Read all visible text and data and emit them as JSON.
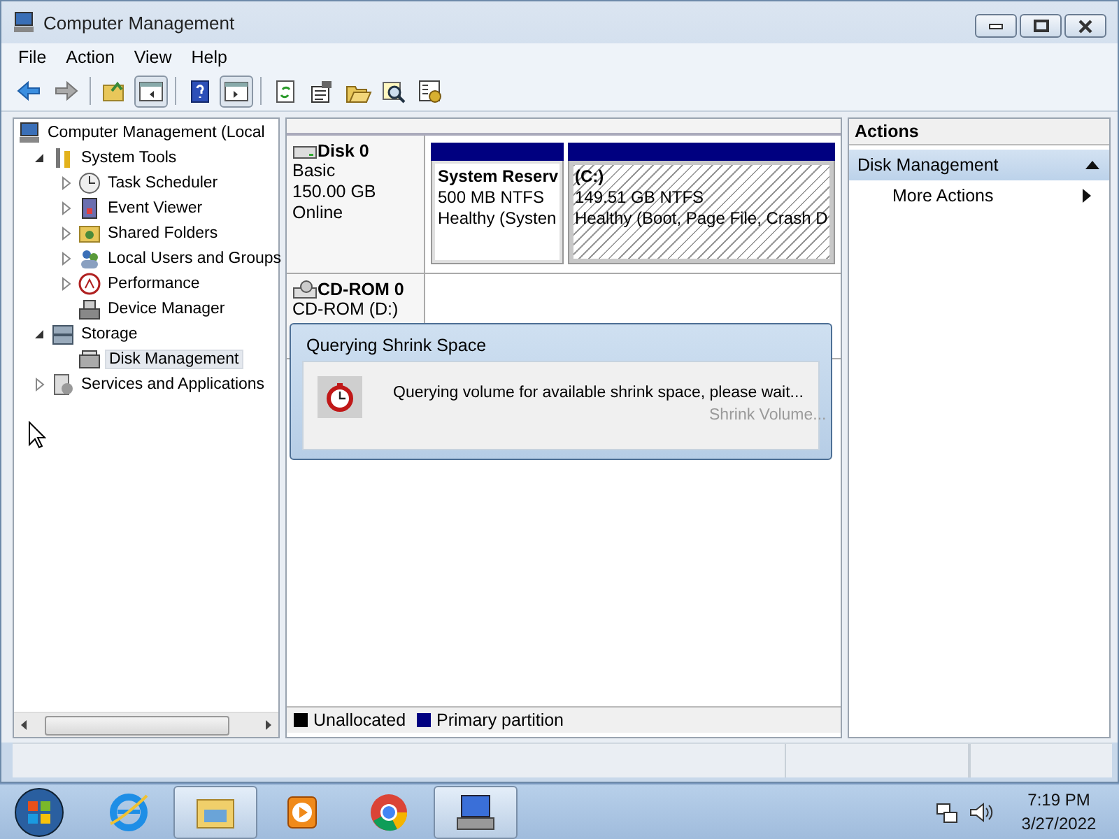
{
  "window": {
    "title": "Computer Management",
    "controls": [
      {
        "kind": "minimize"
      },
      {
        "kind": "maximize"
      },
      {
        "kind": "close"
      }
    ]
  },
  "menu": [
    "File",
    "Action",
    "View",
    "Help"
  ],
  "toolbar": [
    {
      "kind": "back",
      "pressed": false
    },
    {
      "kind": "forward",
      "pressed": false
    },
    {
      "kind": "sep"
    },
    {
      "kind": "up",
      "pressed": false
    },
    {
      "kind": "tree",
      "pressed": true
    },
    {
      "kind": "sep"
    },
    {
      "kind": "help",
      "pressed": false
    },
    {
      "kind": "pane",
      "pressed": true
    },
    {
      "kind": "sep"
    },
    {
      "kind": "refresh",
      "pressed": false
    },
    {
      "kind": "properties",
      "pressed": false
    },
    {
      "kind": "open",
      "pressed": false
    },
    {
      "kind": "find",
      "pressed": false
    },
    {
      "kind": "settings",
      "pressed": false
    }
  ],
  "tree": [
    {
      "label": "Computer Management (Local",
      "kind": "computer",
      "selected": false,
      "children": [
        {
          "label": "System Tools",
          "kind": "tools",
          "expanded": true,
          "selected": false,
          "children": [
            {
              "label": "Task Scheduler",
              "kind": "clock",
              "expanded": false,
              "selected": false
            },
            {
              "label": "Event Viewer",
              "kind": "log",
              "expanded": false,
              "selected": false
            },
            {
              "label": "Shared Folders",
              "kind": "share",
              "expanded": false,
              "selected": false
            },
            {
              "label": "Local Users and Groups",
              "kind": "users",
              "expanded": false,
              "selected": false
            },
            {
              "label": "Performance",
              "kind": "perf",
              "expanded": false,
              "selected": false
            },
            {
              "label": "Device Manager",
              "kind": "device",
              "selected": false
            }
          ]
        },
        {
          "label": "Storage",
          "kind": "storage",
          "expanded": true,
          "selected": false,
          "children": [
            {
              "label": "Disk Management",
              "kind": "disk",
              "selected": true
            }
          ]
        },
        {
          "label": "Services and Applications",
          "kind": "services",
          "expanded": false,
          "selected": false
        }
      ]
    }
  ],
  "disks": [
    {
      "kind": "disk",
      "name": "Disk 0",
      "lines": [
        "Basic",
        "150.00 GB",
        "Online"
      ],
      "partitions": [
        {
          "name": "System Reserv",
          "size": "500 MB NTFS",
          "status": "Healthy (Systen",
          "selected": false
        },
        {
          "name": "(C:)",
          "size": "149.51 GB NTFS",
          "status": "Healthy (Boot, Page File, Crash D",
          "selected": true
        }
      ]
    },
    {
      "kind": "cdrom",
      "name": "CD-ROM 0",
      "lines": [
        "CD-ROM (D:)"
      ]
    }
  ],
  "legend": [
    {
      "label": "Unallocated",
      "color": "#000000"
    },
    {
      "label": "Primary partition",
      "color": "#000080"
    }
  ],
  "dialog": {
    "title": "Querying Shrink Space",
    "message": "Querying volume for available shrink space, please wait..."
  },
  "ghost_item": "Shrink Volume...",
  "actions": {
    "title": "Actions",
    "sections": [
      {
        "title": "Disk Management",
        "expanded": true,
        "items": [
          {
            "label": "More Actions",
            "submenu": true
          }
        ]
      }
    ]
  },
  "taskbar": {
    "apps": [
      {
        "kind": "ie",
        "open": false
      },
      {
        "kind": "explorer",
        "open": true
      },
      {
        "kind": "media",
        "open": false
      },
      {
        "kind": "chrome",
        "open": false
      },
      {
        "kind": "compmgmt",
        "open": true
      }
    ],
    "time": "7:19 PM",
    "date": "3/27/2022"
  }
}
